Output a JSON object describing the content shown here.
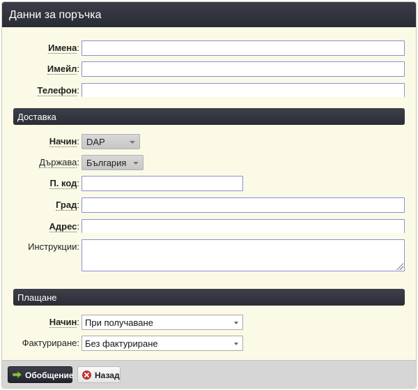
{
  "header": {
    "title": "Данни за поръчка"
  },
  "contact": {
    "name_label": "Имена",
    "email_label": "Имейл",
    "phone_label": "Телефон"
  },
  "delivery": {
    "section_title": "Доставка",
    "method_label": "Начин",
    "method_value": "DAP",
    "country_label": "Държава",
    "country_value": "България",
    "postcode_label": "П. код",
    "city_label": "Град",
    "address_label": "Адрес",
    "instructions_label": "Инструкции"
  },
  "payment": {
    "section_title": "Плащане",
    "method_label": "Начин",
    "method_value": "При получаване",
    "invoicing_label": "Фактуриране",
    "invoicing_value": "Без фактуриране"
  },
  "footer": {
    "summary_button": "Обобщение",
    "back_button": "Назад"
  },
  "colors": {
    "panel_bg": "#fbfae6",
    "header_bg": "#2e303a",
    "input_border": "#8c8cd8",
    "footer_bg": "#d6d6d6"
  },
  "icons": {
    "summary_icon": "right-arrow-icon",
    "back_icon": "close-circle-icon"
  }
}
